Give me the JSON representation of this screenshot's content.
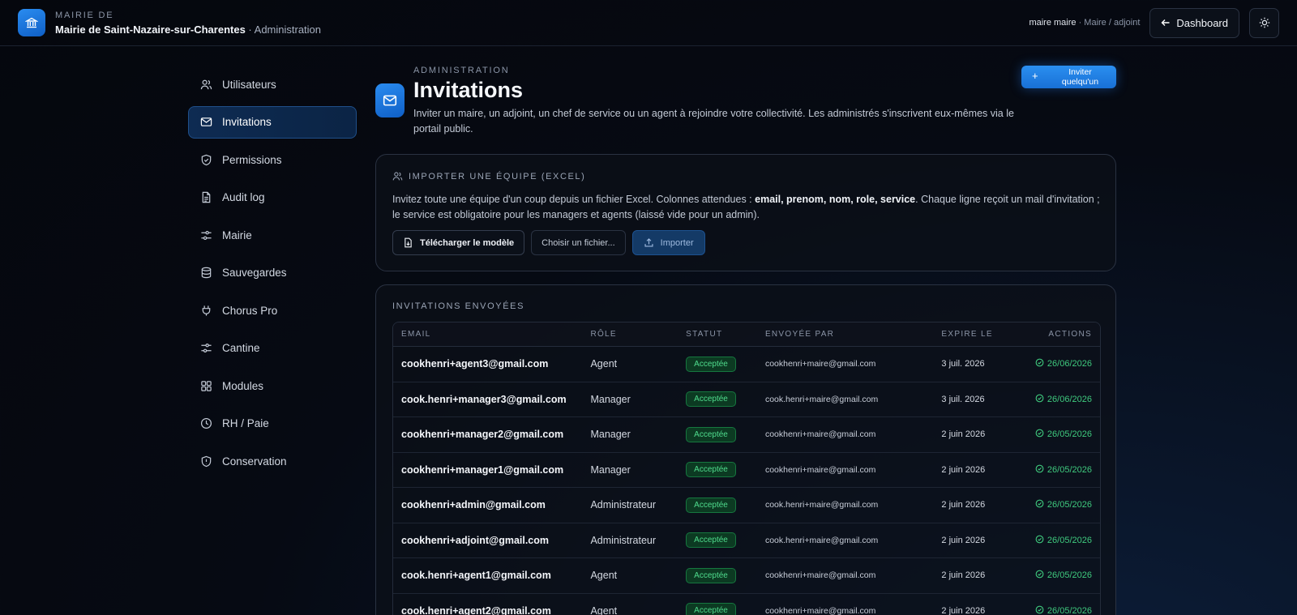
{
  "header": {
    "kicker": "MAIRIE DE",
    "name": "Mairie de Saint-Nazaire-sur-Charentes",
    "section": "· Administration",
    "user": "maire maire",
    "role": "· Maire / adjoint",
    "dashboard_label": "Dashboard"
  },
  "sidebar": {
    "items": [
      {
        "label": "Utilisateurs",
        "icon": "users-icon"
      },
      {
        "label": "Invitations",
        "icon": "mail-icon"
      },
      {
        "label": "Permissions",
        "icon": "shield-icon"
      },
      {
        "label": "Audit log",
        "icon": "document-icon"
      },
      {
        "label": "Mairie",
        "icon": "sliders-icon"
      },
      {
        "label": "Sauvegardes",
        "icon": "database-icon"
      },
      {
        "label": "Chorus Pro",
        "icon": "plug-icon"
      },
      {
        "label": "Cantine",
        "icon": "sliders-icon"
      },
      {
        "label": "Modules",
        "icon": "grid-icon"
      },
      {
        "label": "RH / Paie",
        "icon": "clock-icon"
      },
      {
        "label": "Conservation",
        "icon": "shield-icon"
      }
    ],
    "active": "Invitations"
  },
  "page": {
    "kicker": "ADMINISTRATION",
    "title": "Invitations",
    "description": "Inviter un maire, un adjoint, un chef de service ou un agent à rejoindre votre collectivité. Les administrés s'inscrivent eux-mêmes via le portail public.",
    "invite_button": "Inviter quelqu'un"
  },
  "import": {
    "title": "IMPORTER UNE ÉQUIPE (EXCEL)",
    "desc_before": "Invitez toute une équipe d'un coup depuis un fichier Excel. Colonnes attendues : ",
    "desc_bold": "email, prenom, nom, role, service",
    "desc_after": ". Chaque ligne reçoit un mail d'invitation ; le service est obligatoire pour les managers et agents (laissé vide pour un admin).",
    "download_label": "Télécharger le modèle",
    "choose_label": "Choisir un fichier...",
    "import_label": "Importer"
  },
  "list": {
    "title": "INVITATIONS ENVOYÉES",
    "columns": [
      "EMAIL",
      "RÔLE",
      "STATUT",
      "ENVOYÉE PAR",
      "EXPIRE LE",
      "ACTIONS"
    ],
    "rows": [
      {
        "email": "cookhenri+agent3@gmail.com",
        "role": "Agent",
        "status": "Acceptée",
        "by": "cookhenri+maire@gmail.com",
        "expires": "3 juil. 2026",
        "action": "26/06/2026"
      },
      {
        "email": "cook.henri+manager3@gmail.com",
        "role": "Manager",
        "status": "Acceptée",
        "by": "cook.henri+maire@gmail.com",
        "expires": "3 juil. 2026",
        "action": "26/06/2026"
      },
      {
        "email": "cookhenri+manager2@gmail.com",
        "role": "Manager",
        "status": "Acceptée",
        "by": "cookhenri+maire@gmail.com",
        "expires": "2 juin 2026",
        "action": "26/05/2026"
      },
      {
        "email": "cookhenri+manager1@gmail.com",
        "role": "Manager",
        "status": "Acceptée",
        "by": "cookhenri+maire@gmail.com",
        "expires": "2 juin 2026",
        "action": "26/05/2026"
      },
      {
        "email": "cookhenri+admin@gmail.com",
        "role": "Administrateur",
        "status": "Acceptée",
        "by": "cook.henri+maire@gmail.com",
        "expires": "2 juin 2026",
        "action": "26/05/2026"
      },
      {
        "email": "cookhenri+adjoint@gmail.com",
        "role": "Administrateur",
        "status": "Acceptée",
        "by": "cook.henri+maire@gmail.com",
        "expires": "2 juin 2026",
        "action": "26/05/2026"
      },
      {
        "email": "cook.henri+agent1@gmail.com",
        "role": "Agent",
        "status": "Acceptée",
        "by": "cookhenri+maire@gmail.com",
        "expires": "2 juin 2026",
        "action": "26/05/2026"
      },
      {
        "email": "cook.henri+agent2@gmail.com",
        "role": "Agent",
        "status": "Acceptée",
        "by": "cookhenri+maire@gmail.com",
        "expires": "2 juin 2026",
        "action": "26/05/2026"
      }
    ]
  },
  "colors": {
    "accent": "#2a8cf0",
    "success": "#3fca7e",
    "background": "#05070d"
  }
}
